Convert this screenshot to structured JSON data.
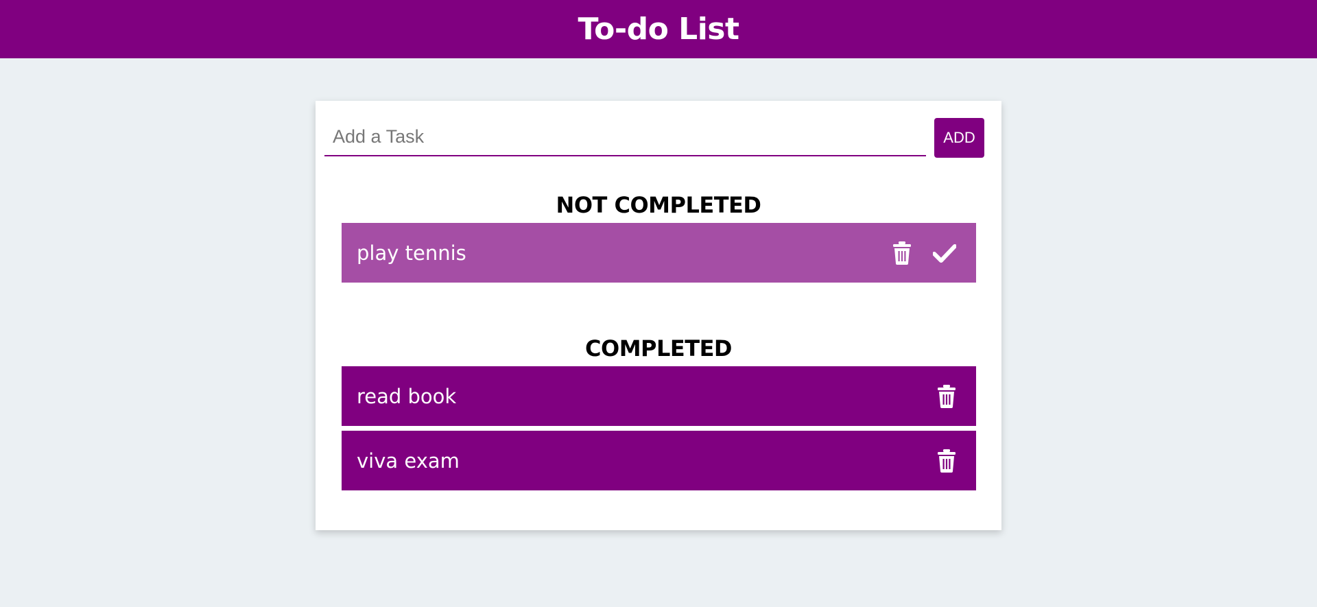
{
  "header": {
    "title": "To-do List"
  },
  "add": {
    "placeholder": "Add a Task",
    "value": "",
    "button_label": "ADD"
  },
  "sections": {
    "not_completed_title": "NOT COMPLETED",
    "completed_title": "COMPLETED"
  },
  "not_completed": [
    {
      "label": "play tennis",
      "actions": [
        "trash-icon",
        "check-icon"
      ]
    }
  ],
  "completed": [
    {
      "label": "read book",
      "actions": [
        "trash-icon"
      ]
    },
    {
      "label": "viva exam",
      "actions": [
        "trash-icon"
      ]
    }
  ],
  "colors": {
    "accent": "#800080",
    "pending_row": "#a54ea5",
    "background": "#ebf0f3",
    "card": "#ffffff"
  }
}
